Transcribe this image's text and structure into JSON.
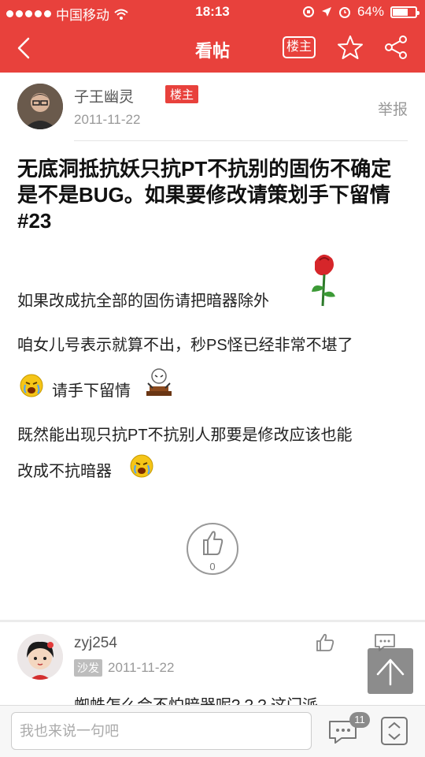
{
  "status_bar": {
    "carrier": "中国移动",
    "time": "18:13",
    "battery": "64%",
    "battery_level": 0.64
  },
  "header": {
    "title": "看帖",
    "owner_only_label": "楼主",
    "icons": [
      "back-icon",
      "star-icon",
      "share-icon"
    ]
  },
  "post": {
    "author_name": "子王幽灵",
    "owner_badge": "楼主",
    "date": "2011-11-22",
    "report_label": "举报",
    "title": "无底洞抵抗妖只抗PT不抗别的固伤不确定是不是BUG。如果要修改请策划手下留情#23",
    "lines": [
      "如果改成抗全部的固伤请把暗器除外",
      "咱女儿号表示就算不出，秒PS怪已经非常不堪了",
      "请手下留情",
      "既然能出现只抗PT不抗别人那要是修改应该也能",
      "改成不抗暗器"
    ],
    "like_count": "0"
  },
  "reply": {
    "author_name": "zyj254",
    "floor_badge": "沙发",
    "date": "2011-11-22",
    "text_partial": "蜘蛛怎么会不怕暗器呢? ? ? 这门派"
  },
  "bottom_bar": {
    "input_placeholder": "我也来说一句吧",
    "comment_count": "11"
  },
  "colors": {
    "accent": "#e8413c",
    "muted_text": "#999999"
  }
}
